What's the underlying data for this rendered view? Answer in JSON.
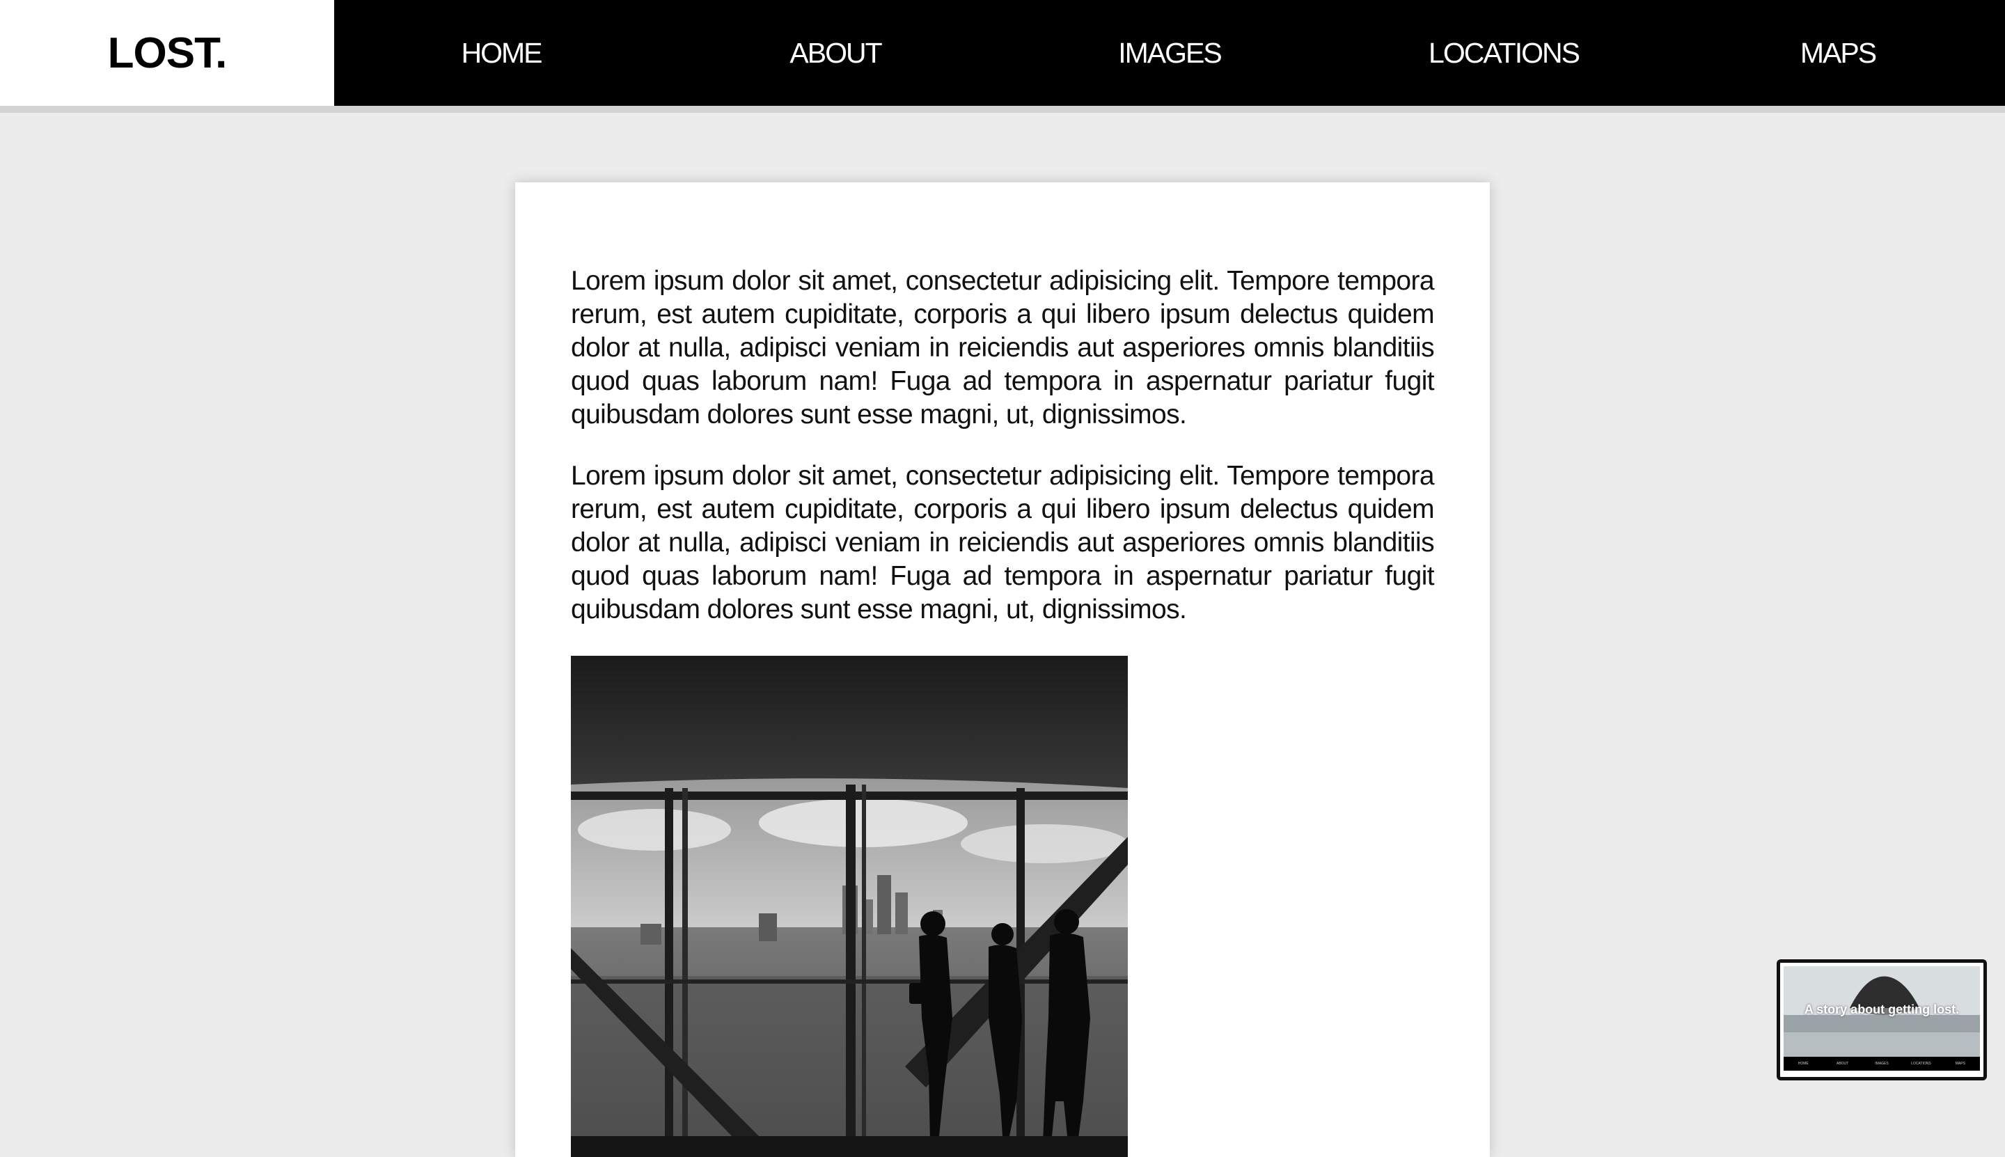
{
  "header": {
    "logo": "LOST.",
    "nav": [
      {
        "label": "HOME"
      },
      {
        "label": "ABOUT"
      },
      {
        "label": "IMAGES"
      },
      {
        "label": "LOCATIONS"
      },
      {
        "label": "MAPS"
      }
    ]
  },
  "content": {
    "paragraphs": [
      "Lorem ipsum dolor sit amet, consectetur adipisicing elit. Tempore tempora rerum, est autem cupiditate, corporis a qui libero ipsum delectus quidem dolor at nulla, adipisci veniam in reiciendis aut asperiores omnis blanditiis quod quas laborum nam! Fuga ad tempora in aspernatur pariatur fugit quibusdam dolores sunt esse magni, ut, dignissimos.",
      "Lorem ipsum dolor sit amet, consectetur adipisicing elit. Tempore tempora rerum, est autem cupiditate, corporis a qui libero ipsum delectus quidem dolor at nulla, adipisci veniam in reiciendis aut asperiores omnis blanditiis quod quas laborum nam! Fuga ad tempora in aspernatur pariatur fugit quibusdam dolores sunt esse magni, ut, dignissimos."
    ]
  },
  "thumbnail": {
    "caption": "A story about getting lost.",
    "nav": [
      "HOME",
      "ABOUT",
      "IMAGES",
      "LOCATIONS",
      "MAPS"
    ]
  },
  "colors": {
    "header_bg": "#000000",
    "page_bg": "#ececec",
    "card_bg": "#ffffff",
    "text": "#111111"
  }
}
